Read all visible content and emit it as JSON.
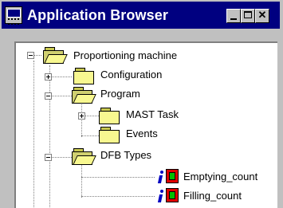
{
  "window": {
    "title": "Application Browser"
  },
  "tree": {
    "root": {
      "label": "Proportioning machine"
    },
    "configuration": {
      "label": "Configuration"
    },
    "program": {
      "label": "Program"
    },
    "mast_task": {
      "label": "MAST Task"
    },
    "events": {
      "label": "Events"
    },
    "dfb_types": {
      "label": "DFB Types"
    },
    "emptying_count": {
      "label": "Emptying_count"
    },
    "filling_count": {
      "label": "Filling_count"
    }
  },
  "colors": {
    "titlebar": "#000080",
    "folder": "#f8f890",
    "dfb_icon": "#e00000"
  }
}
